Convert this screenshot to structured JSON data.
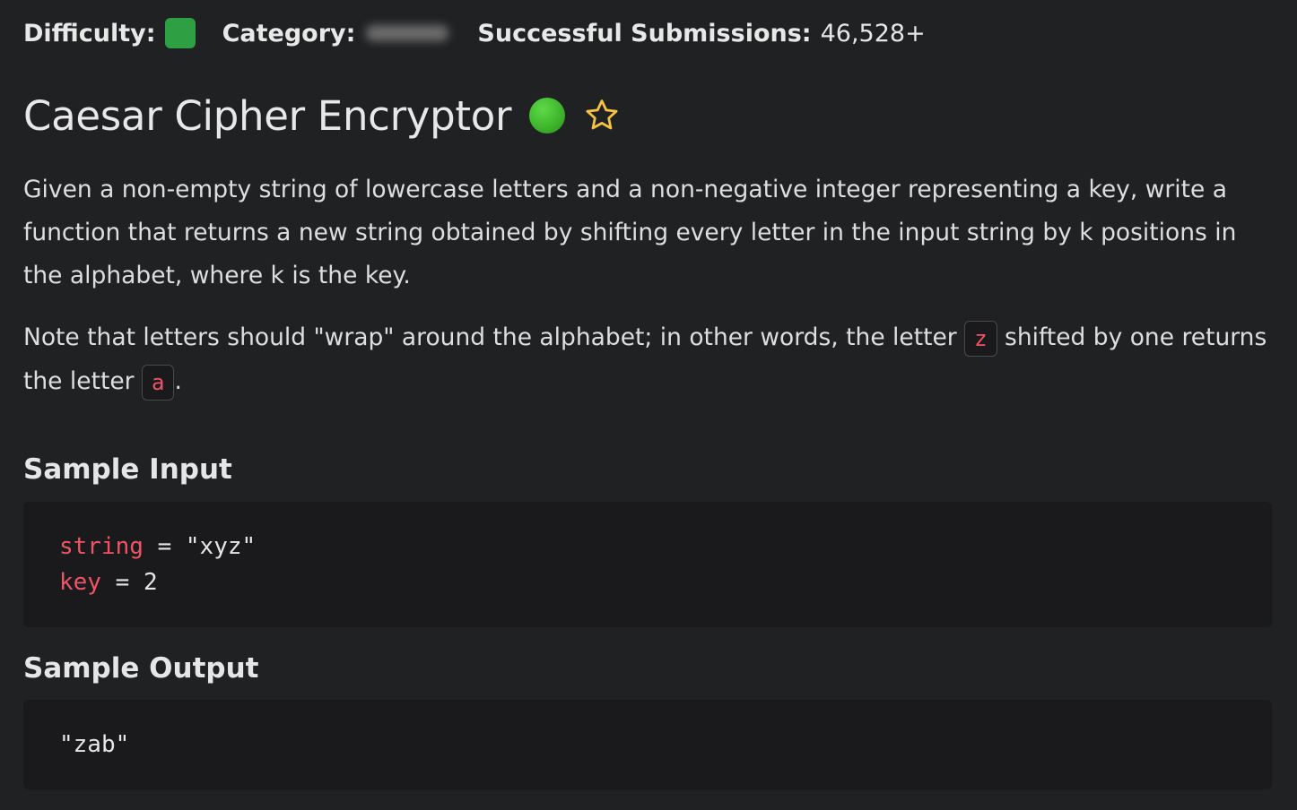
{
  "meta": {
    "difficulty_label": "Difficulty:",
    "difficulty_color": "#2ea043",
    "category_label": "Category:",
    "submissions_label": "Successful Submissions:",
    "submissions_value": "46,528+"
  },
  "problem": {
    "title": "Caesar Cipher Encryptor",
    "status_color": "#3fb62c",
    "star_icon": "star-outline-icon",
    "star_color": "#f5c242"
  },
  "description": {
    "paragraph1": "Given a non-empty string of lowercase letters and a non-negative integer representing a key, write a function that returns a new string obtained by shifting every letter in the input string by k positions in the alphabet, where k is the key.",
    "note_part1": "Note that letters should \"wrap\" around the alphabet; in other words, the letter ",
    "note_code1": "z",
    "note_part2": " shifted by one returns the letter ",
    "note_code2": "a",
    "note_part3": "."
  },
  "sample_input": {
    "heading": "Sample Input",
    "lines": [
      {
        "name": "string",
        "eq": " = ",
        "value": "\"xyz\""
      },
      {
        "name": "key",
        "eq": " = ",
        "value": "2"
      }
    ]
  },
  "sample_output": {
    "heading": "Sample Output",
    "value": "\"zab\""
  },
  "colors": {
    "background": "#202123",
    "code_background": "#1a1a1c",
    "variable": "#ef5466",
    "inline_code": "#ef5466"
  }
}
